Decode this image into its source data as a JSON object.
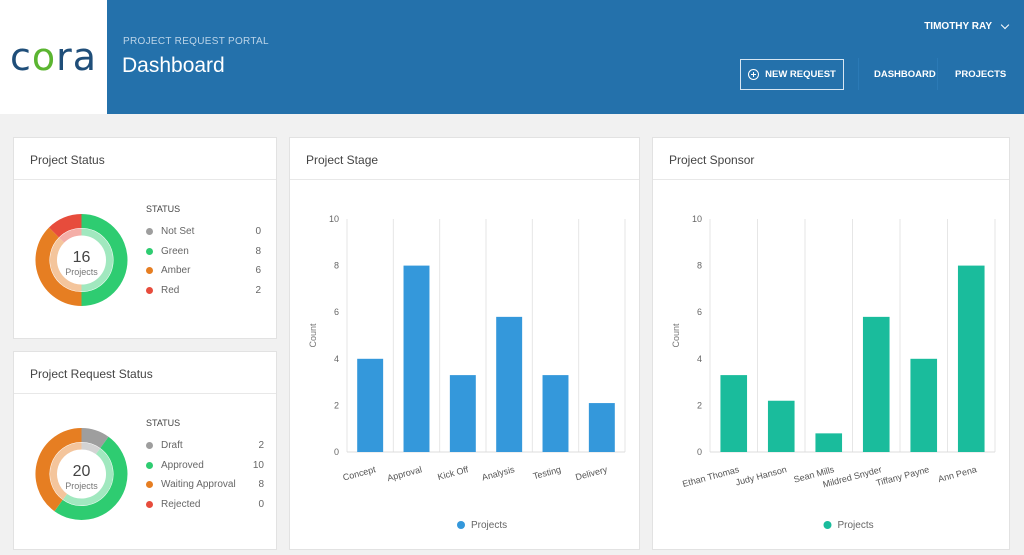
{
  "header": {
    "logo_text_pre": "c",
    "logo_text_o": "o",
    "logo_text_post": "ra",
    "portal_label": "PROJECT REQUEST PORTAL",
    "page_title": "Dashboard",
    "user_name": "TIMOTHY RAY",
    "new_request_label": "NEW REQUEST",
    "nav": [
      {
        "label": "DASHBOARD"
      },
      {
        "label": "PROJECTS"
      }
    ]
  },
  "project_status": {
    "title": "Project Status",
    "total": "16",
    "total_label": "Projects",
    "legend_title": "STATUS",
    "items": [
      {
        "label": "Not Set",
        "value": "0",
        "color": "#9e9e9e"
      },
      {
        "label": "Green",
        "value": "8",
        "color": "#2ecc71"
      },
      {
        "label": "Amber",
        "value": "6",
        "color": "#e67e22"
      },
      {
        "label": "Red",
        "value": "2",
        "color": "#e74c3c"
      }
    ]
  },
  "project_request_status": {
    "title": "Project Request Status",
    "total": "20",
    "total_label": "Projects",
    "legend_title": "STATUS",
    "items": [
      {
        "label": "Draft",
        "value": "2",
        "color": "#9e9e9e"
      },
      {
        "label": "Approved",
        "value": "10",
        "color": "#2ecc71"
      },
      {
        "label": "Waiting Approval",
        "value": "8",
        "color": "#e67e22"
      },
      {
        "label": "Rejected",
        "value": "0",
        "color": "#e74c3c"
      }
    ]
  },
  "chart_data": [
    {
      "type": "bar",
      "title": "Project Stage",
      "categories": [
        "Concept",
        "Approval",
        "Kick Off",
        "Analysis",
        "Testing",
        "Delivery"
      ],
      "series": [
        {
          "name": "Projects",
          "values": [
            4,
            8,
            3.3,
            5.8,
            3.3,
            2.1
          ],
          "color": "#3498db"
        }
      ],
      "xlabel": "",
      "ylabel": "Count",
      "ylim": [
        0,
        10
      ],
      "yticks": [
        0,
        2,
        4,
        6,
        8,
        10
      ],
      "grid": "vertical",
      "legend": "bottom-center"
    },
    {
      "type": "bar",
      "title": "Project Sponsor",
      "categories": [
        "Ethan Thomas",
        "Judy Hanson",
        "Sean Mills",
        "Mildred Snyder",
        "Tiffany Payne",
        "Ann Pena"
      ],
      "series": [
        {
          "name": "Projects",
          "values": [
            3.3,
            2.2,
            0.8,
            5.8,
            4,
            8
          ],
          "color": "#1abc9c"
        }
      ],
      "xlabel": "",
      "ylabel": "Count",
      "ylim": [
        0,
        10
      ],
      "yticks": [
        0,
        2,
        4,
        6,
        8,
        10
      ],
      "grid": "vertical",
      "legend": "bottom-center"
    }
  ]
}
